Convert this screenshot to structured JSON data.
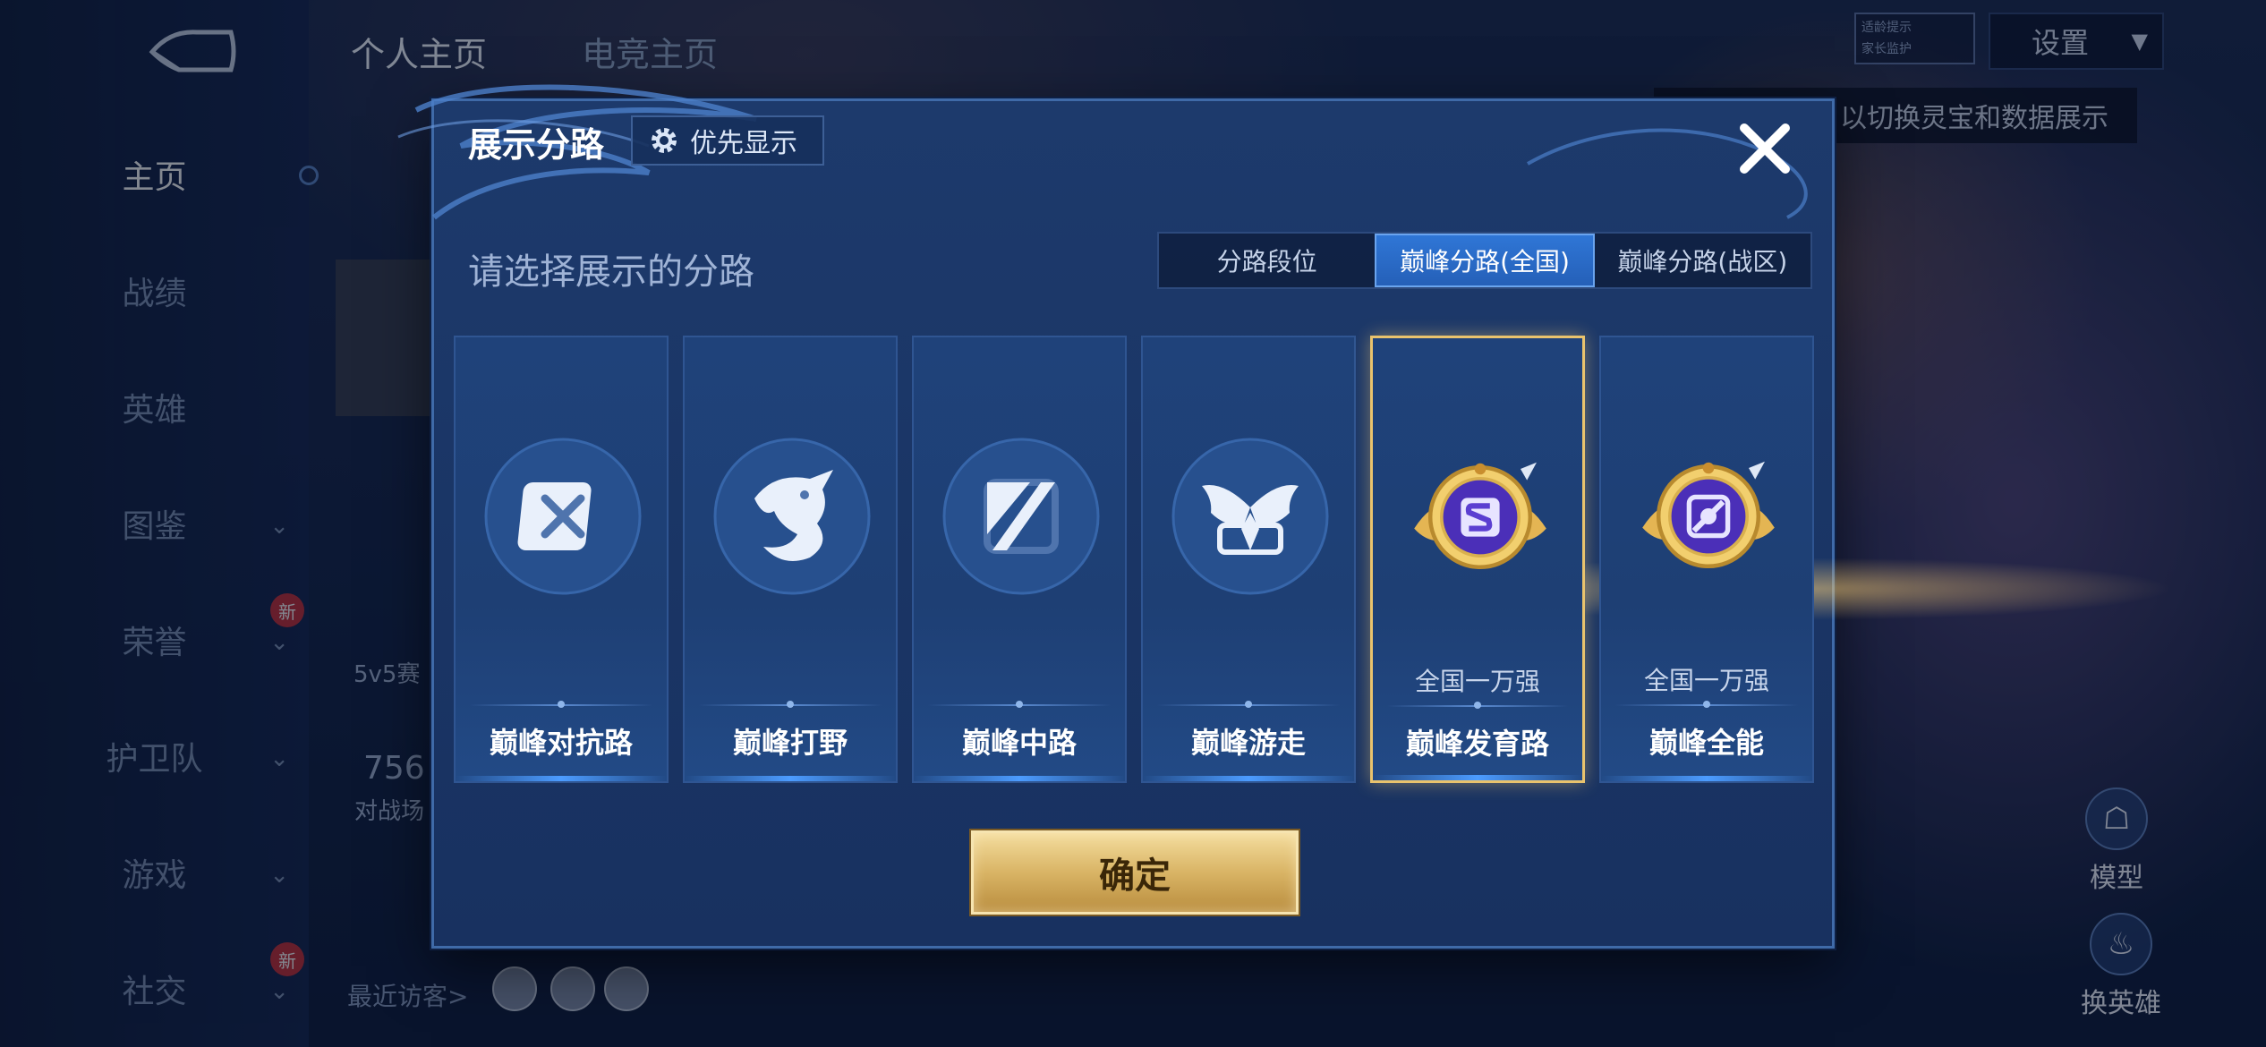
{
  "background": {
    "top_tabs": [
      "个人主页",
      "电竞主页"
    ],
    "settings_label": "设置",
    "age_badge_lines": [
      "适龄提示",
      "家长监护"
    ],
    "hint_text": "以切换灵宝和数据展示",
    "profile_lines": [
      "5v5赛",
      "756",
      "对战场"
    ],
    "visitor_label": "最近访客>",
    "right_controls": [
      "模型",
      "换英雄"
    ]
  },
  "sidebar": {
    "items": [
      {
        "label": "主页",
        "active": true
      },
      {
        "label": "战绩"
      },
      {
        "label": "英雄"
      },
      {
        "label": "图鉴",
        "chevron": true
      },
      {
        "label": "荣誉",
        "chevron": true,
        "badge": "新"
      },
      {
        "label": "护卫队",
        "chevron": true
      },
      {
        "label": "游戏",
        "chevron": true
      },
      {
        "label": "社交",
        "chevron": true,
        "badge": "新"
      }
    ]
  },
  "modal": {
    "title": "展示分路",
    "priority_label": "优先显示",
    "subtitle": "请选择展示的分路",
    "tabs": [
      {
        "label": "分路段位"
      },
      {
        "label": "巅峰分路(全国)",
        "active": true
      },
      {
        "label": "巅峰分路(战区)"
      }
    ],
    "cards": [
      {
        "label": "巅峰对抗路",
        "rank": "",
        "icon": "sword-icon"
      },
      {
        "label": "巅峰打野",
        "rank": "",
        "icon": "dragon-icon"
      },
      {
        "label": "巅峰中路",
        "rank": "",
        "icon": "slash-icon"
      },
      {
        "label": "巅峰游走",
        "rank": "",
        "icon": "wings-icon"
      },
      {
        "label": "巅峰发育路",
        "rank": "全国一万强",
        "icon": "gold-badge-icon",
        "selected": true
      },
      {
        "label": "巅峰全能",
        "rank": "全国一万强",
        "icon": "gold-badge-icon"
      }
    ],
    "confirm_label": "确定"
  },
  "colors": {
    "accent_blue": "#2f76d6",
    "gold": "#d9b465",
    "modal_bg": "#1d3a6c"
  }
}
